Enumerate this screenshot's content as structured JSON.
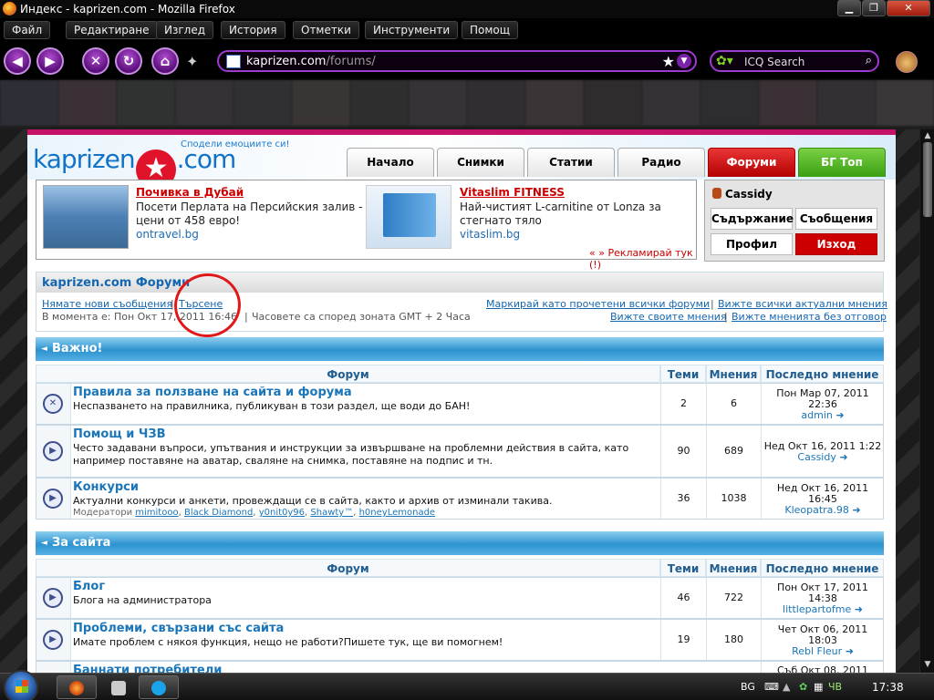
{
  "window": {
    "title": "Индекс - kaprizen.com - Mozilla Firefox"
  },
  "menu": [
    "Файл",
    "Редактиране",
    "Изглед",
    "История",
    "Отметки",
    "Инструменти",
    "Помощ"
  ],
  "urlbar": {
    "domain": "kaprizen.com",
    "path": "/forums/"
  },
  "search": {
    "placeholder": "ICQ Search"
  },
  "site": {
    "logo_left": "kaprizen",
    "logo_right": ".com",
    "slogan": "Сподели емоциите си!",
    "tabs": [
      "Начало",
      "Снимки",
      "Статии",
      "Радио",
      "Форуми",
      "БГ Топ"
    ]
  },
  "ads": [
    {
      "title": "Почивка в Дубай",
      "line1": "Посети Перлата на Персийския залив -",
      "line2": "цени от 458 евро!",
      "link": "ontravel.bg"
    },
    {
      "title": "Vitaslim FITNESS",
      "line1": "Най-чистият L-carnitine от Lonza за",
      "line2": "стегнато тяло",
      "link": "vitaslim.bg"
    }
  ],
  "ad_promo": "« »  Рекламирай тук (!)",
  "user": {
    "name": "Cassidy",
    "buttons": [
      "Съдържание",
      "Съобщения",
      "Профил",
      "Изход"
    ]
  },
  "forum_header": {
    "title": "kaprizen.com Форуми",
    "links_left": [
      "Нямате нови съобщения",
      "Търсене"
    ],
    "links_right": [
      "Маркирай като прочетени всички форуми",
      "Вижте всички актуални мнения"
    ],
    "status_prefix": "В момента е: Пон Окт 17, 2011 16:46",
    "status_tz": "Часовете са според зоната GMT + 2 Часа",
    "links_right2": [
      "Вижте своите мнения",
      "Вижте мненията без отговор"
    ]
  },
  "columns": {
    "forum": "Форум",
    "topics": "Теми",
    "posts": "Мнения",
    "last": "Последно мнение"
  },
  "sections": [
    {
      "title": "Важно!",
      "forums": [
        {
          "name": "Правила за ползване на сайта и форума",
          "desc": "Неспазването на правилника, публикуван в този раздел, ще води до БАН!",
          "topics": "2",
          "posts": "6",
          "last_date": "Пон Мар 07, 2011",
          "last_time": "22:36",
          "last_user": "admin",
          "locked": true
        },
        {
          "name": "Помощ и ЧЗВ",
          "desc": "Често задавани въпроси, упътвания и инструкции за извършване на проблемни действия в сайта, като например поставяне на аватар, сваляне на снимка, поставяне на подпис и тн.",
          "topics": "90",
          "posts": "689",
          "last_date": "Нед Окт 16, 2011 1:22",
          "last_time": "",
          "last_user": "Cassidy",
          "locked": false
        },
        {
          "name": "Конкурси",
          "desc": "Актуални конкурси и анкети, провеждащи се в сайта, както и архив от изминали такива.",
          "topics": "36",
          "posts": "1038",
          "last_date": "Нед Окт 16, 2011",
          "last_time": "16:45",
          "last_user": "Kleopatra.98",
          "locked": false,
          "mods_label": "Модератори",
          "mods": [
            "mimitooo",
            "Black Diamond",
            "y0nit0y96",
            "Shawty™",
            "h0neyLemonade"
          ]
        }
      ]
    },
    {
      "title": "За сайта",
      "forums": [
        {
          "name": "Блог",
          "desc": "Блога на администратора",
          "topics": "46",
          "posts": "722",
          "last_date": "Пон Окт 17, 2011",
          "last_time": "14:38",
          "last_user": "littlepartofme",
          "locked": false
        },
        {
          "name": "Проблеми, свързани със сайта",
          "desc": "Имате проблем с някоя функция, нещо не работи?Пишете тук, ще ви помогнем!",
          "topics": "19",
          "posts": "180",
          "last_date": "Чет Окт 06, 2011",
          "last_time": "18:03",
          "last_user": "Rebl Fleur",
          "locked": false
        },
        {
          "name": "Баннати потребители",
          "desc": "",
          "topics": "",
          "posts": "",
          "last_date": "Съб Окт 08, 2011",
          "last_time": "",
          "last_user": "",
          "locked": false
        }
      ]
    }
  ],
  "taskbar": {
    "lang": "BG",
    "day": "ЧВ",
    "clock": "17:38"
  },
  "colors": {
    "accent": "#1466b0",
    "tab_active": "#cc0000",
    "tab_green": "#4cae1d",
    "highlight_circle": "#e0181a"
  }
}
